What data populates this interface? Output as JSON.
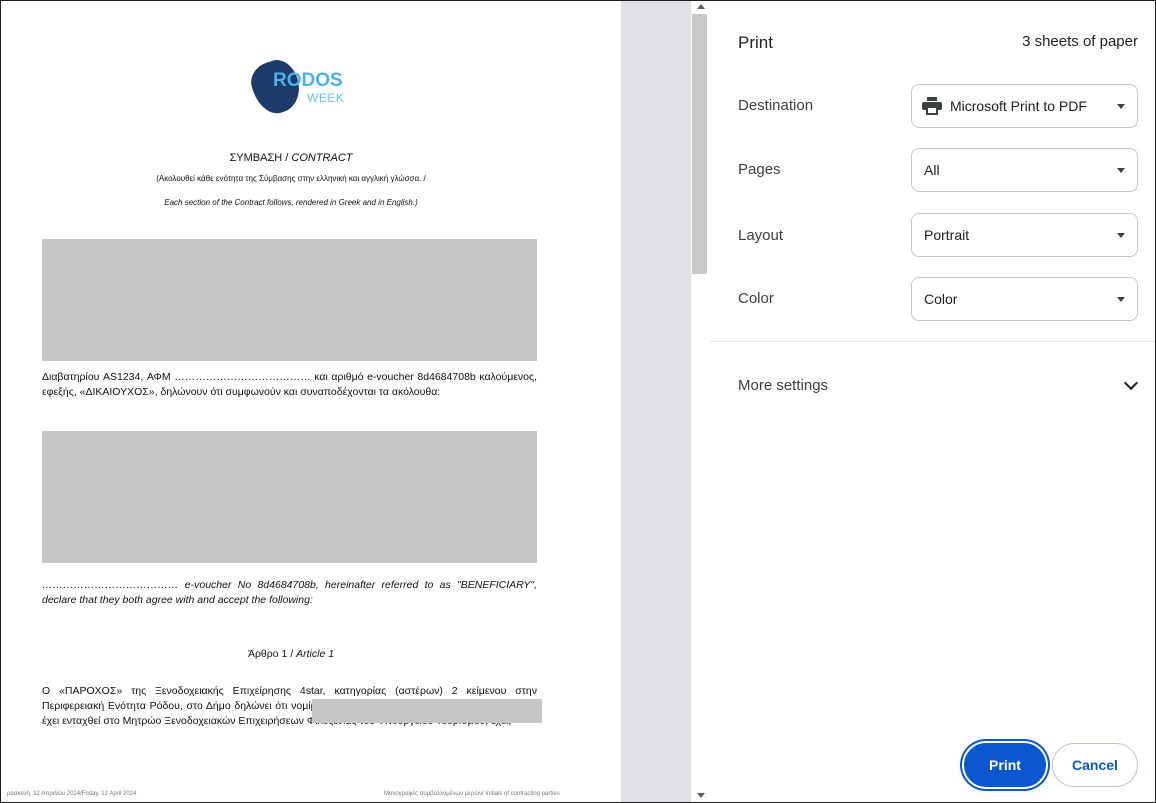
{
  "preview": {
    "logo": {
      "text": "RODOS",
      "sub": "WEEK"
    },
    "title_main": "ΣΥΜΒΑΣΗ / ",
    "title_italic": "CONTRACT",
    "note_greek": "(Ακολουθεί κάθε ενότητα της Σύμβασης στην ελληνική και αγγλική γλώσσα. /",
    "note_english": "Each section of the Contract follows, rendered in Greek and in English.)",
    "para1": "Διαβατηρίου AS1234, ΑΦΜ ………………………………… και αριθμό e-voucher 8d4684708b καλούμενος, εφεξής, «ΔΙΚΑΙΟΥΧΟΣ», δηλώνουν ότι συμφωνούν και συναποδέχονται τα ακόλουθα:",
    "para2": "………………………………… e-voucher No 8d4684708b, hereinafter referred to as \"BENEFICIARY\", declare that they both agree with and accept the following:",
    "article_greek": "Άρθρο 1 / ",
    "article_english": "Article 1",
    "para3": "Ο «ΠΑΡΟΧΟΣ» της Ξενοδοχειακής Επιχείρησης 4star, κατηγορίας (αστέρων) 2 κείμενου στην Περιφερειακή Ενότητα Ρόδου, στο Δήμο δηλώνει ότι νομίμως συμμετέχει στο πρόγραμμα \"Rodos Week\", έχει ενταχθεί στο Μητρώο Ξενοδοχειακών Επιχειρήσεων Φιλοξενίας του Υπουργείου Τουρισμού, έχει,",
    "footer_left": "ρασκευή, 12 Απριλίου 2024/Friday, 12 April 2024",
    "footer_right": "Μονογραφές συμβαλλομένων μερών/ Initials of contracting parties"
  },
  "panel": {
    "title": "Print",
    "sheets": "3 sheets of paper",
    "rows": [
      {
        "label": "Destination",
        "value": "Microsoft Print to PDF",
        "icon": "printer-icon"
      },
      {
        "label": "Pages",
        "value": "All"
      },
      {
        "label": "Layout",
        "value": "Portrait"
      },
      {
        "label": "Color",
        "value": "Color"
      }
    ],
    "more_settings": "More settings",
    "print_button": "Print",
    "cancel_button": "Cancel"
  },
  "colors": {
    "accent": "#0b57d0",
    "redaction": "#c6c6c6",
    "gutter": "#dfe1e5"
  }
}
